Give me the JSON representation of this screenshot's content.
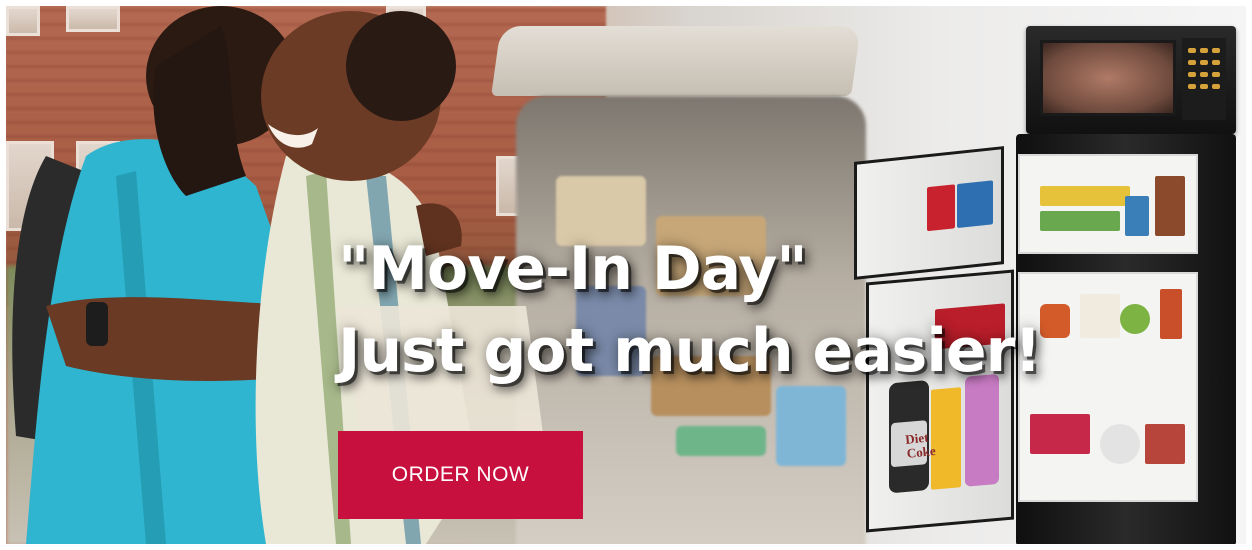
{
  "hero": {
    "headline_line1": "\"Move-In Day\"",
    "headline_line2": "Just got much easier!",
    "cta_label": "ORDER NOW",
    "image_label": "Diet Coke"
  },
  "colors": {
    "cta_background": "#c8103e",
    "headline_text": "#ffffff",
    "appliance_body": "#111111"
  }
}
